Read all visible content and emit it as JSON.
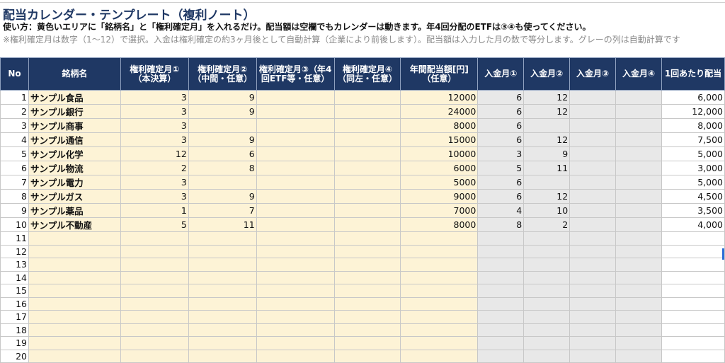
{
  "sheet": {
    "title": "配当カレンダー・テンプレート（複利ノート）",
    "instructions": "使い方：黄色いエリアに「銘柄名」と「権利確定月」を入れるだけ。配当額は空欄でもカレンダーは動きます。年4回分配のETFは③④も使ってください。",
    "notes": "※権利確定月は数字（1〜12）で選択。入金は権利確定の約3ヶ月後として自動計算（企業により前後します）。配当額は入力した月の数で等分します。グレーの列は自動計算です"
  },
  "table": {
    "headers": [
      "No",
      "銘柄名",
      "権利確定月①（本決算）",
      "権利確定月②（中間・任意）",
      "権利確定月③（年4回ETF等・任意）",
      "権利確定月④（同左・任意）",
      "年間配当額[円]（任意）",
      "入金月①",
      "入金月②",
      "入金月③",
      "入金月④",
      "1回あたり配当"
    ],
    "rows": [
      [
        "1",
        "サンプル食品",
        "3",
        "9",
        "",
        "",
        "12000",
        "6",
        "12",
        "",
        "",
        "6,000"
      ],
      [
        "2",
        "サンプル銀行",
        "3",
        "9",
        "",
        "",
        "24000",
        "6",
        "12",
        "",
        "",
        "12,000"
      ],
      [
        "3",
        "サンプル商事",
        "3",
        "",
        "",
        "",
        "8000",
        "6",
        "",
        "",
        "",
        "8,000"
      ],
      [
        "4",
        "サンプル通信",
        "3",
        "9",
        "",
        "",
        "15000",
        "6",
        "12",
        "",
        "",
        "7,500"
      ],
      [
        "5",
        "サンプル化学",
        "12",
        "6",
        "",
        "",
        "10000",
        "3",
        "9",
        "",
        "",
        "5,000"
      ],
      [
        "6",
        "サンプル物流",
        "2",
        "8",
        "",
        "",
        "6000",
        "5",
        "11",
        "",
        "",
        "3,000"
      ],
      [
        "7",
        "サンプル電力",
        "3",
        "",
        "",
        "",
        "5000",
        "6",
        "",
        "",
        "",
        "5,000"
      ],
      [
        "8",
        "サンプルガス",
        "3",
        "9",
        "",
        "",
        "9000",
        "6",
        "12",
        "",
        "",
        "4,500"
      ],
      [
        "9",
        "サンプル薬品",
        "1",
        "7",
        "",
        "",
        "7000",
        "4",
        "10",
        "",
        "",
        "3,500"
      ],
      [
        "10",
        "サンプル不動産",
        "5",
        "11",
        "",
        "",
        "8000",
        "8",
        "2",
        "",
        "",
        "4,000"
      ],
      [
        "11",
        "",
        "",
        "",
        "",
        "",
        "",
        "",
        "",
        "",
        "",
        ""
      ],
      [
        "12",
        "",
        "",
        "",
        "",
        "",
        "",
        "",
        "",
        "",
        "",
        ""
      ],
      [
        "13",
        "",
        "",
        "",
        "",
        "",
        "",
        "",
        "",
        "",
        "",
        ""
      ],
      [
        "14",
        "",
        "",
        "",
        "",
        "",
        "",
        "",
        "",
        "",
        "",
        ""
      ],
      [
        "15",
        "",
        "",
        "",
        "",
        "",
        "",
        "",
        "",
        "",
        "",
        ""
      ],
      [
        "16",
        "",
        "",
        "",
        "",
        "",
        "",
        "",
        "",
        "",
        "",
        ""
      ],
      [
        "17",
        "",
        "",
        "",
        "",
        "",
        "",
        "",
        "",
        "",
        "",
        ""
      ],
      [
        "18",
        "",
        "",
        "",
        "",
        "",
        "",
        "",
        "",
        "",
        "",
        ""
      ],
      [
        "19",
        "",
        "",
        "",
        "",
        "",
        "",
        "",
        "",
        "",
        "",
        ""
      ],
      [
        "20",
        "",
        "",
        "",
        "",
        "",
        "",
        "",
        "",
        "",
        "",
        ""
      ]
    ]
  },
  "colors": {
    "header_bg": "#1f3864",
    "input_bg": "#fdf3d6",
    "calc_bg": "#e8e8e8"
  }
}
